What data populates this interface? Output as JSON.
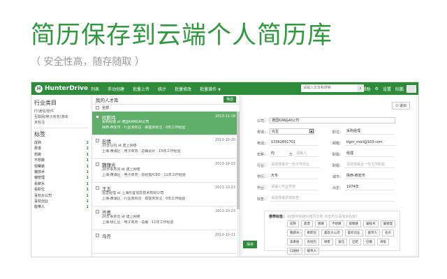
{
  "headline": "简历保存到云端个人简历库",
  "subline": "（ 安全性高，随存随取 ）",
  "app": {
    "logo_text": "HunterDrive",
    "nav": [
      "列表",
      "手动创建",
      "批量上传",
      "统计",
      "批量修改",
      "批量操作"
    ],
    "search_placeholder": "请输入文本和搜索",
    "search_icon": "search-icon",
    "top_right": [
      "帮助",
      "设置",
      "际鹏"
    ],
    "sidebar": {
      "industry_title": "行业类目",
      "industries": [
        "IT/通信/软件",
        "互联网/电子商务/游戏",
        "未标注"
      ],
      "tags_title": "标签",
      "tags": [
        {
          "name": "成熟",
          "count": "2"
        },
        {
          "name": "靠谱",
          "count": "2"
        },
        {
          "name": "想跳",
          "count": "1"
        },
        {
          "name": "不想跳",
          "count": "1"
        },
        {
          "name": "观察跳",
          "count": "1"
        },
        {
          "name": "偏技术",
          "count": "1"
        },
        {
          "name": "偏管理",
          "count": "1"
        },
        {
          "name": "看薪水",
          "count": "1"
        },
        {
          "name": "看职位",
          "count": "1"
        },
        {
          "name": "喜欢大公司",
          "count": "1"
        },
        {
          "name": "喜欢创业",
          "count": "1"
        },
        {
          "name": "能带人",
          "count": "1"
        }
      ]
    },
    "list": {
      "title": "我的人才库",
      "filter_label": "筛选",
      "select_all": "全部",
      "candidates": [
        {
          "name": "程鹏玮",
          "date": "2013-11-18",
          "line1": "采购经理 at 德国KANGAI公司",
          "line2": "陕西-西安市 · 行业未标注 · 职能未标注 · 0年工作经验"
        },
        {
          "name": "彭倩",
          "date": "2013-10-30",
          "line1": "20岁以内 at 建上网络",
          "line2": "上海-黄浦区 · 电子商务 · 总裁设计 · 15年工作经验"
        },
        {
          "name": "魏瑾光",
          "date": "2013-10-23",
          "line1": "20岁事务员 at 建上网络",
          "line2": "上海-黄浦区 · 电子商务 · 总经理/CEO · 11年工作经验"
        },
        {
          "name": "王五",
          "date": "2013-10-23",
          "line1": "运营经理 at 上海乐宜信息技术有限公司",
          "line2": "上海-黄浦区 · 行业未标注 · 职能未标注 · 0年工作经验"
        },
        {
          "name": "齐思",
          "date": "2013-10-23",
          "line1": "20岁事务员 at 建上网络",
          "line2": "上海-徐汇区 · 电子商务 · 总裁 · 11年工作经验"
        },
        {
          "name": "马齐",
          "date": "2013-10-21",
          "line1": "",
          "line2": ""
        }
      ]
    },
    "detail": {
      "exit_label": "退出",
      "fields": {
        "company_label": "公司：",
        "company_value": "德国KANGAI公司",
        "title_label": "称谓：",
        "title_value": "先生",
        "position_label": "职位：",
        "position_value": "采购经理",
        "phone_label": "电话：",
        "phone_value": "13362891701",
        "email_label": "邮箱：",
        "email_value": "tiger_mail@163.com",
        "salary_label": "年薪：",
        "salary_from": "约",
        "salary_unit": "万",
        "salary_placeholder": "请输入",
        "function_label": "职能：",
        "function_value": "经理",
        "industry_label": "行业：",
        "industry_placeholder": "请选择最近一份工作行业",
        "sub_function_label": "职能：",
        "sub_function_placeholder": "请选择最近一份工作职能",
        "education_label": "学历：",
        "education_value": "大专",
        "city_label": "城市：",
        "city_value": "陕西-西安市",
        "school_label": "毕业：",
        "school_placeholder": "请输入毕业学校",
        "birth_label": "出生：",
        "birth_value": "1974年",
        "tags_label": "标签：",
        "tags_placeholder": "请选择或添加标签"
      },
      "recommend_title": "推荐标签：",
      "recommend_hint": "（标签可快速对简历分类 点击可以添加该标签）",
      "chips": [
        "成熟",
        "靠谱",
        "想跳",
        "不想跳",
        "观察跳",
        "偏技术",
        "偏管理",
        "看薪水",
        "看职位",
        "喜欢大公司",
        "喜欢创业",
        "能带人",
        "名声",
        "高素质",
        "有经历",
        "顾客",
        "鬼马",
        "已结",
        "已婚",
        "海龟",
        "口语好",
        "能带人"
      ],
      "save_label": "保存"
    }
  }
}
